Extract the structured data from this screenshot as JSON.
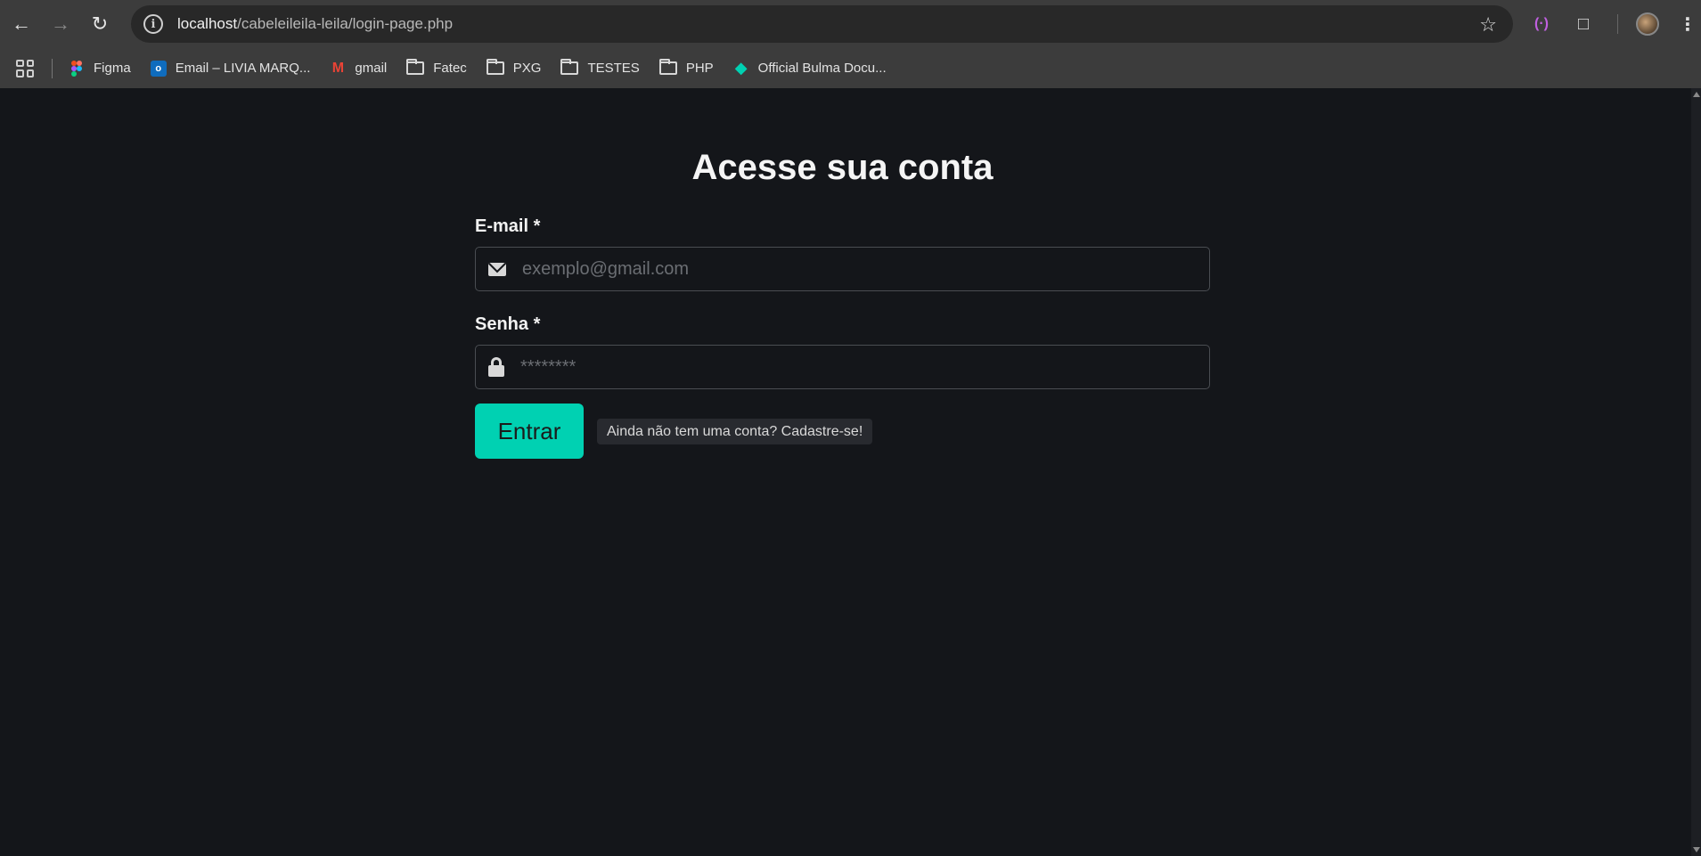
{
  "browser": {
    "url_host": "localhost",
    "url_path": "/cabeleileila-leila/login-page.php",
    "bookmarks": [
      {
        "label": "Figma",
        "icon": "figma-icon"
      },
      {
        "label": "Email – LIVIA MARQ...",
        "icon": "outlook-icon"
      },
      {
        "label": "gmail",
        "icon": "gmail-icon"
      },
      {
        "label": "Fatec",
        "icon": "folder-icon"
      },
      {
        "label": "PXG",
        "icon": "folder-icon"
      },
      {
        "label": "TESTES",
        "icon": "folder-icon"
      },
      {
        "label": "PHP",
        "icon": "folder-icon"
      },
      {
        "label": "Official Bulma Docu...",
        "icon": "bulma-icon"
      }
    ]
  },
  "login": {
    "title": "Acesse sua conta",
    "email_label": "E-mail *",
    "email_placeholder": "exemplo@gmail.com",
    "password_label": "Senha *",
    "password_placeholder": "********",
    "submit_label": "Entrar",
    "signup_link": "Ainda não tem uma conta? Cadastre-se!"
  },
  "colors": {
    "page_background": "#14161a",
    "primary": "#00d1b2",
    "chrome": "#3c3c3c"
  }
}
